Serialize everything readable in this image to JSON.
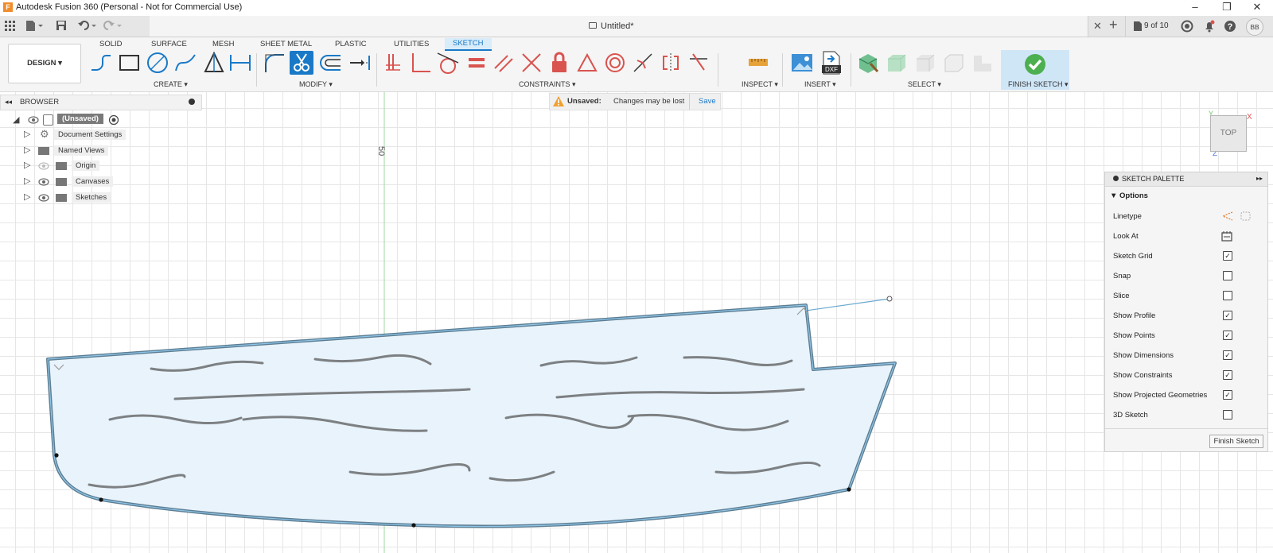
{
  "window": {
    "title": "Autodesk Fusion 360 (Personal - Not for Commercial Use)",
    "app_icon": "F",
    "controls": [
      "–",
      "❐",
      "✕"
    ]
  },
  "tabbar": {
    "doc_title": "Untitled*",
    "close_glyph": "✕",
    "new_tab_glyph": "+",
    "job_status": "9 of 10",
    "user_initials": "BB"
  },
  "toolbar": {
    "workspace_button": "DESIGN ▾",
    "workspace_tabs": [
      "SOLID",
      "SURFACE",
      "MESH",
      "SHEET METAL",
      "PLASTIC",
      "UTILITIES",
      "SKETCH"
    ],
    "active_tab": "SKETCH",
    "groups": {
      "create": "CREATE ▾",
      "modify": "MODIFY ▾",
      "constraints": "CONSTRAINTS ▾",
      "inspect": "INSPECT ▾",
      "insert": "INSERT ▾",
      "select": "SELECT ▾",
      "finish": "FINISH SKETCH ▾"
    },
    "insert_dxf_label": "DXF"
  },
  "browser": {
    "header": "BROWSER",
    "root": "(Unsaved)",
    "items": [
      "Document Settings",
      "Named Views",
      "Origin",
      "Canvases",
      "Sketches"
    ]
  },
  "notice": {
    "title": "Unsaved:",
    "message": "Changes may be lost",
    "action": "Save"
  },
  "viewport": {
    "ruler_label": "50",
    "viewcube_face": "TOP",
    "axis_x": "X",
    "axis_y": "Y",
    "axis_z": "Z"
  },
  "palette": {
    "header": "SKETCH PALETTE",
    "section": "▼ Options",
    "rows": [
      {
        "label": "Linetype",
        "checked": null
      },
      {
        "label": "Look At",
        "checked": null
      },
      {
        "label": "Sketch Grid",
        "checked": true
      },
      {
        "label": "Snap",
        "checked": false
      },
      {
        "label": "Slice",
        "checked": false
      },
      {
        "label": "Show Profile",
        "checked": true
      },
      {
        "label": "Show Points",
        "checked": true
      },
      {
        "label": "Show Dimensions",
        "checked": true
      },
      {
        "label": "Show Constraints",
        "checked": true
      },
      {
        "label": "Show Projected Geometries",
        "checked": true
      },
      {
        "label": "3D Sketch",
        "checked": false
      }
    ],
    "finish_button": "Finish Sketch"
  },
  "colors": {
    "accent": "#1a79c7",
    "profile_fill": "#e8f3fc",
    "profile_stroke": "#5e7d91",
    "finish_green": "#4caf50"
  }
}
